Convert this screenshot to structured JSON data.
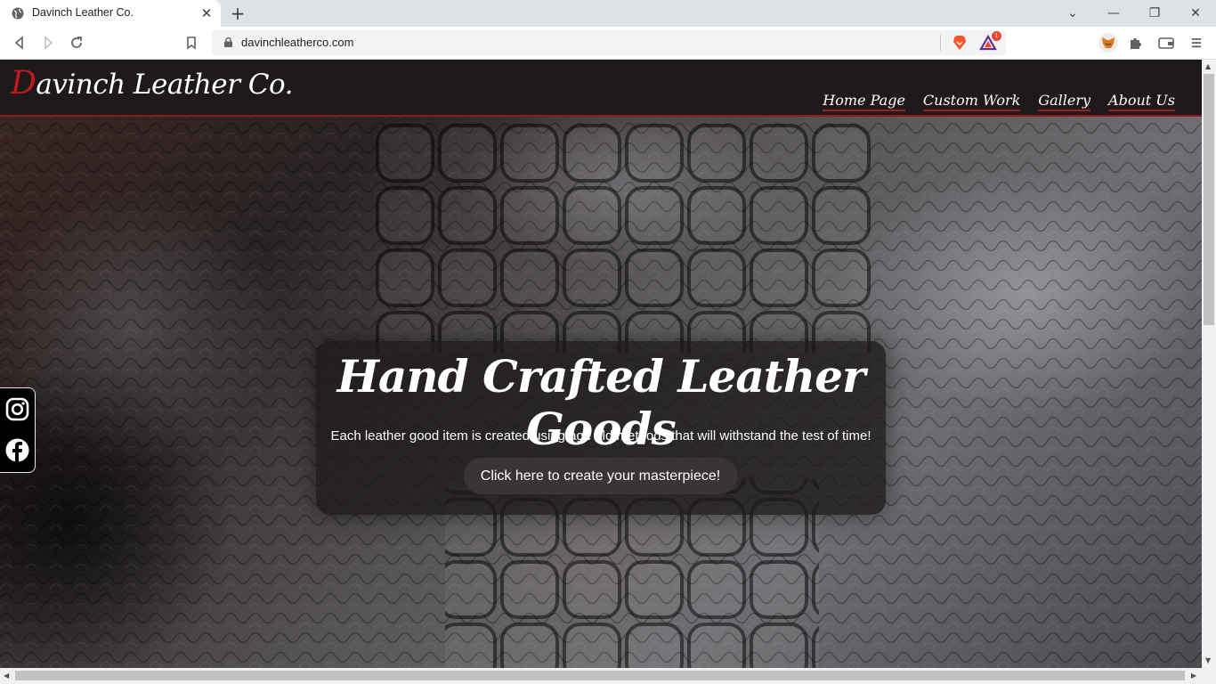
{
  "browser": {
    "tab_title": "Davinch Leather Co.",
    "tab_close": "✕",
    "new_tab": "+",
    "url": "davinchleatherco.com",
    "extension_badge": "1"
  },
  "site": {
    "logo_initial": "D",
    "logo_rest": "avinch Leather Co.",
    "nav": [
      "Home Page",
      "Custom Work",
      "Gallery",
      "About Us"
    ],
    "hero_title": "Hand Crafted Leather Goods",
    "hero_subtitle": "Each leather good item is created using age old methods that will withstand the test of time!",
    "cta_label": "Click here to create your masterpiece!"
  },
  "colors": {
    "header_bg": "#1e1a1b",
    "accent_red": "#c01a1a",
    "nav_underline": "#a01c1c"
  },
  "icons": [
    "globe-icon",
    "lock-icon",
    "bookmark-icon",
    "brave-lion-icon",
    "brave-rewards-icon",
    "metamask-fox-icon",
    "puzzle-icon",
    "wallet-icon",
    "instagram-icon",
    "facebook-icon"
  ]
}
